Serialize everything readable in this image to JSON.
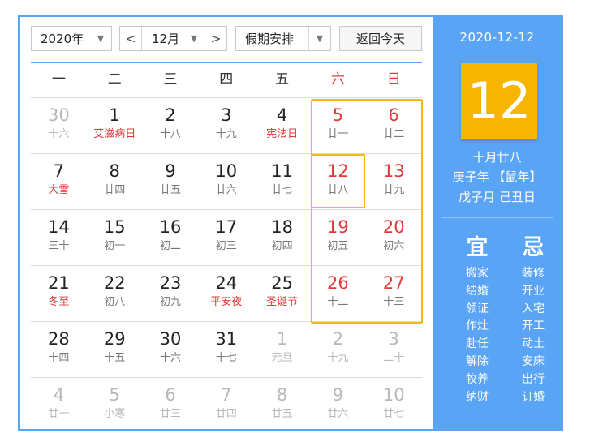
{
  "toolbar": {
    "year": "2020年",
    "prev": "<",
    "month": "12月",
    "next": ">",
    "holiday": "假期安排",
    "today": "返回今天",
    "dropdown_icon": "▼"
  },
  "weekdays": [
    "一",
    "二",
    "三",
    "四",
    "五",
    "六",
    "日"
  ],
  "rows": [
    [
      {
        "num": "30",
        "lunar": "十六",
        "other": true
      },
      {
        "num": "1",
        "lunar": "艾滋病日",
        "fest": true
      },
      {
        "num": "2",
        "lunar": "十八"
      },
      {
        "num": "3",
        "lunar": "十九"
      },
      {
        "num": "4",
        "lunar": "宪法日",
        "fest": true
      },
      {
        "num": "5",
        "lunar": "廿一"
      },
      {
        "num": "6",
        "lunar": "廿二"
      }
    ],
    [
      {
        "num": "7",
        "lunar": "大雪",
        "fest": true
      },
      {
        "num": "8",
        "lunar": "廿四"
      },
      {
        "num": "9",
        "lunar": "廿五"
      },
      {
        "num": "10",
        "lunar": "廿六"
      },
      {
        "num": "11",
        "lunar": "廿七"
      },
      {
        "num": "12",
        "lunar": "廿八"
      },
      {
        "num": "13",
        "lunar": "廿九"
      }
    ],
    [
      {
        "num": "14",
        "lunar": "三十"
      },
      {
        "num": "15",
        "lunar": "初一"
      },
      {
        "num": "16",
        "lunar": "初二"
      },
      {
        "num": "17",
        "lunar": "初三"
      },
      {
        "num": "18",
        "lunar": "初四"
      },
      {
        "num": "19",
        "lunar": "初五"
      },
      {
        "num": "20",
        "lunar": "初六"
      }
    ],
    [
      {
        "num": "21",
        "lunar": "冬至",
        "fest": true
      },
      {
        "num": "22",
        "lunar": "初八"
      },
      {
        "num": "23",
        "lunar": "初九"
      },
      {
        "num": "24",
        "lunar": "平安夜",
        "fest": true
      },
      {
        "num": "25",
        "lunar": "圣诞节",
        "fest": true
      },
      {
        "num": "26",
        "lunar": "十二"
      },
      {
        "num": "27",
        "lunar": "十三"
      }
    ],
    [
      {
        "num": "28",
        "lunar": "十四"
      },
      {
        "num": "29",
        "lunar": "十五"
      },
      {
        "num": "30",
        "lunar": "十六"
      },
      {
        "num": "31",
        "lunar": "十七"
      },
      {
        "num": "1",
        "lunar": "元旦",
        "other": true
      },
      {
        "num": "2",
        "lunar": "十九",
        "other": true
      },
      {
        "num": "3",
        "lunar": "二十",
        "other": true
      }
    ],
    [
      {
        "num": "4",
        "lunar": "廿一",
        "other": true
      },
      {
        "num": "5",
        "lunar": "小寒",
        "other": true
      },
      {
        "num": "6",
        "lunar": "廿三",
        "other": true
      },
      {
        "num": "7",
        "lunar": "廿四",
        "other": true
      },
      {
        "num": "8",
        "lunar": "廿五",
        "other": true
      },
      {
        "num": "9",
        "lunar": "廿六",
        "other": true
      },
      {
        "num": "10",
        "lunar": "廿七",
        "other": true
      }
    ]
  ],
  "side": {
    "date": "2020-12-12",
    "day": "12",
    "lunar_date": "十月廿八",
    "year_ganzhi": "庚子年 【鼠年】",
    "month_day_ganzhi": "戊子月 己丑日",
    "yi_title": "宜",
    "ji_title": "忌",
    "yi": [
      "搬家",
      "结婚",
      "领证",
      "作灶",
      "赴任",
      "解除",
      "牧养",
      "纳财"
    ],
    "ji": [
      "装修",
      "开业",
      "入宅",
      "开工",
      "动土",
      "安床",
      "出行",
      "订婚"
    ]
  },
  "colors": {
    "accent": "#5aa4f5",
    "highlight": "#f4b81a",
    "day_badge": "#f8b500",
    "festival": "#e03a3a"
  }
}
